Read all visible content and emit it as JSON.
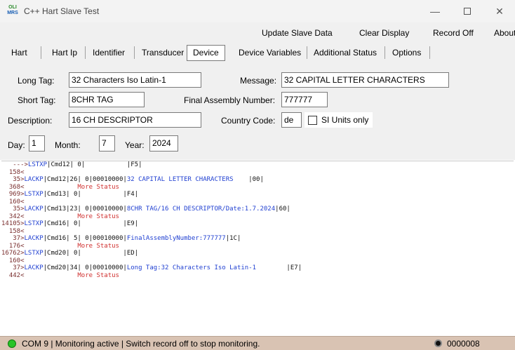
{
  "window": {
    "icon_text_top": "OLI",
    "icon_text_bottom": "MRS",
    "title": "C++ Hart Slave Test",
    "min_glyph": "—",
    "close_glyph": "✕"
  },
  "menu": {
    "update": "Update Slave Data",
    "clear": "Clear Display",
    "record": "Record Off",
    "about": "About"
  },
  "tabs": [
    "Hart",
    "Hart Ip",
    "Identifier",
    "Transducer",
    "Device",
    "Device Variables",
    "Additional Status",
    "Options"
  ],
  "active_tab": "Device",
  "form": {
    "long_tag_label": "Long Tag:",
    "long_tag_value": "32 Characters Iso Latin-1",
    "message_label": "Message:",
    "message_value": "32 CAPITAL LETTER CHARACTERS",
    "short_tag_label": "Short Tag:",
    "short_tag_value": "8CHR TAG",
    "final_assembly_label": "Final Assembly Number:",
    "final_assembly_value": "777777",
    "description_label": "Description:",
    "description_value": "16 CH DESCRIPTOR",
    "country_code_label": "Country Code:",
    "country_code_value": "de",
    "si_units_label": "SI Units only",
    "si_units_checked": false,
    "day_label": "Day:",
    "day_value": "1",
    "month_label": "Month:",
    "month_value": "7",
    "year_label": "Year:",
    "year_value": "2024"
  },
  "log": [
    [
      {
        "t": "   --->",
        "c": "c-time"
      },
      {
        "t": "LSTXP",
        "c": "c-blue"
      },
      {
        "t": "|Cmd12| 0|           |F5|",
        "c": "c-black"
      }
    ],
    [
      {
        "t": "  158<",
        "c": "c-time"
      }
    ],
    [
      {
        "t": "   35>",
        "c": "c-time"
      },
      {
        "t": "LACKP",
        "c": "c-blue"
      },
      {
        "t": "|Cmd12|26| 0|00010000|",
        "c": "c-black"
      },
      {
        "t": "32 CAPITAL LETTER CHARACTERS",
        "c": "c-blue"
      },
      {
        "t": "    |00|",
        "c": "c-black"
      }
    ],
    [
      {
        "t": "  368<",
        "c": "c-time"
      },
      {
        "t": "              More Status",
        "c": "c-red"
      }
    ],
    [
      {
        "t": "  969>",
        "c": "c-time"
      },
      {
        "t": "LSTXP",
        "c": "c-blue"
      },
      {
        "t": "|Cmd13| 0|           |F4|",
        "c": "c-black"
      }
    ],
    [
      {
        "t": "  160<",
        "c": "c-time"
      }
    ],
    [
      {
        "t": "   35>",
        "c": "c-time"
      },
      {
        "t": "LACKP",
        "c": "c-blue"
      },
      {
        "t": "|Cmd13|23| 0|00010000|",
        "c": "c-black"
      },
      {
        "t": "8CHR TAG/16 CH DESCRIPTOR/Date:1.7.2024",
        "c": "c-blue"
      },
      {
        "t": "|60|",
        "c": "c-black"
      }
    ],
    [
      {
        "t": "  342<",
        "c": "c-time"
      },
      {
        "t": "              More Status",
        "c": "c-red"
      }
    ],
    [
      {
        "t": "14105>",
        "c": "c-time"
      },
      {
        "t": "LSTXP",
        "c": "c-blue"
      },
      {
        "t": "|Cmd16| 0|           |E9|",
        "c": "c-black"
      }
    ],
    [
      {
        "t": "  158<",
        "c": "c-time"
      }
    ],
    [
      {
        "t": "   37>",
        "c": "c-time"
      },
      {
        "t": "LACKP",
        "c": "c-blue"
      },
      {
        "t": "|Cmd16| 5| 0|00010000|",
        "c": "c-black"
      },
      {
        "t": "FinalAssemblyNumber:777777",
        "c": "c-blue"
      },
      {
        "t": "|1C|",
        "c": "c-black"
      }
    ],
    [
      {
        "t": "  176<",
        "c": "c-time"
      },
      {
        "t": "              More Status",
        "c": "c-red"
      }
    ],
    [
      {
        "t": "16762>",
        "c": "c-time"
      },
      {
        "t": "LSTXP",
        "c": "c-blue"
      },
      {
        "t": "|Cmd20| 0|           |ED|",
        "c": "c-black"
      }
    ],
    [
      {
        "t": "  160<",
        "c": "c-time"
      }
    ],
    [
      {
        "t": "   37>",
        "c": "c-time"
      },
      {
        "t": "LACKP",
        "c": "c-blue"
      },
      {
        "t": "|Cmd20|34| 0|00010000|",
        "c": "c-black"
      },
      {
        "t": "Long Tag:32 Characters Iso Latin-1",
        "c": "c-blue"
      },
      {
        "t": "        |E7|",
        "c": "c-black"
      }
    ],
    [
      {
        "t": "  442<",
        "c": "c-time"
      },
      {
        "t": "              More Status",
        "c": "c-red"
      }
    ]
  ],
  "status": {
    "text": "COM 9 | Monitoring active | Switch record off to stop monitoring.",
    "record_count": "0000008",
    "active_color": "#28c428"
  }
}
